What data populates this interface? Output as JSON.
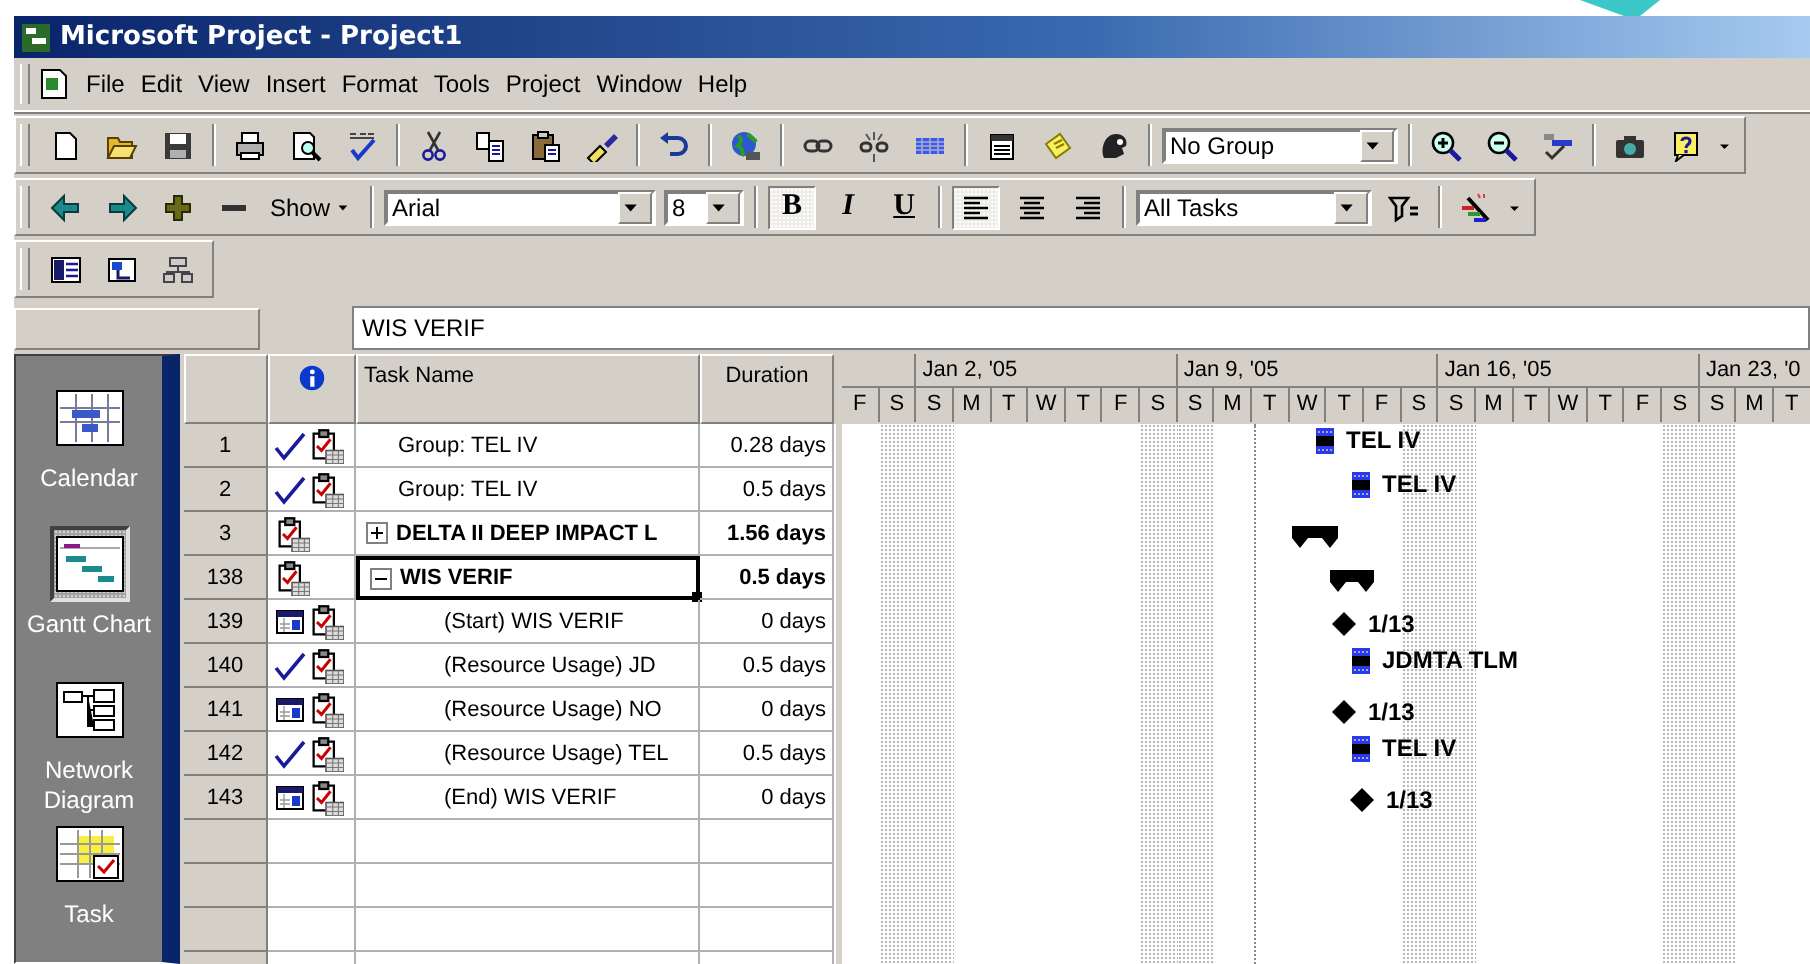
{
  "window": {
    "title": "Microsoft Project - Project1"
  },
  "menu": [
    "File",
    "Edit",
    "View",
    "Insert",
    "Format",
    "Tools",
    "Project",
    "Window",
    "Help"
  ],
  "toolbar_standard": {
    "group_box": {
      "value": "No Group"
    }
  },
  "toolbar_formatting": {
    "show_button": {
      "label": "Show"
    },
    "font_box": {
      "value": "Arial"
    },
    "size_box": {
      "value": "8"
    },
    "style_buttons": [
      {
        "kind": "bold",
        "label": "B",
        "pressed": true
      },
      {
        "kind": "italic",
        "label": "I",
        "pressed": false
      },
      {
        "kind": "underline",
        "label": "U",
        "pressed": false
      }
    ],
    "align_buttons": [
      {
        "kind": "left",
        "pressed": true
      },
      {
        "kind": "center",
        "pressed": false
      },
      {
        "kind": "right",
        "pressed": false
      }
    ],
    "filter_box": {
      "value": "All Tasks"
    }
  },
  "entry_bar": {
    "value": "WIS VERIF"
  },
  "view_bar": [
    {
      "kind": "calendar",
      "label": "Calendar",
      "selected": false
    },
    {
      "kind": "gantt",
      "label": "Gantt Chart",
      "selected": true
    },
    {
      "kind": "network",
      "label": "Network Diagram",
      "selected": false
    },
    {
      "kind": "usage",
      "label": "Task",
      "selected": false
    }
  ],
  "table": {
    "columns": [
      {
        "kind": "id"
      },
      {
        "kind": "indicators"
      },
      {
        "kind": "name",
        "label": "Task Name"
      },
      {
        "kind": "duration",
        "label": "Duration"
      }
    ],
    "tasks": [
      {
        "id": "1",
        "kind": "task",
        "name": "Group: TEL IV",
        "duration": "0.28 days",
        "selected": false,
        "indicators": [
          {
            "kind": "complete"
          },
          {
            "kind": "note"
          }
        ],
        "bar": {
          "kind": "task",
          "label": "TEL IV"
        }
      },
      {
        "id": "2",
        "kind": "task",
        "name": "Group: TEL IV",
        "duration": "0.5 days",
        "selected": false,
        "indicators": [
          {
            "kind": "complete"
          },
          {
            "kind": "note"
          }
        ],
        "bar": {
          "kind": "task",
          "label": "TEL IV"
        }
      },
      {
        "id": "3",
        "kind": "summary",
        "name": "DELTA II DEEP IMPACT L",
        "duration": "1.56 days",
        "selected": false,
        "expanded": false,
        "indicators": [
          {
            "kind": "note"
          }
        ],
        "bar": {
          "kind": "summary"
        }
      },
      {
        "id": "138",
        "kind": "summary",
        "name": "WIS VERIF",
        "duration": "0.5 days",
        "selected": true,
        "expanded": true,
        "indicators": [
          {
            "kind": "note"
          }
        ],
        "bar": {
          "kind": "summary"
        },
        "children": [
          {
            "id": "139",
            "kind": "task",
            "name": "(Start) WIS VERIF",
            "duration": "0 days",
            "selected": false,
            "indicators": [
              {
                "kind": "constraint"
              },
              {
                "kind": "note"
              }
            ],
            "bar": {
              "kind": "milestone",
              "label": "1/13"
            }
          },
          {
            "id": "140",
            "kind": "task",
            "name": "(Resource Usage) JD",
            "duration": "0.5 days",
            "selected": false,
            "indicators": [
              {
                "kind": "complete"
              },
              {
                "kind": "note"
              }
            ],
            "bar": {
              "kind": "task",
              "label": "JDMTA TLM"
            }
          },
          {
            "id": "141",
            "kind": "task",
            "name": "(Resource Usage) NO",
            "duration": "0 days",
            "selected": false,
            "indicators": [
              {
                "kind": "constraint"
              },
              {
                "kind": "note"
              }
            ],
            "bar": {
              "kind": "milestone",
              "label": "1/13"
            }
          },
          {
            "id": "142",
            "kind": "task",
            "name": "(Resource Usage) TEL",
            "duration": "0.5 days",
            "selected": false,
            "indicators": [
              {
                "kind": "complete"
              },
              {
                "kind": "note"
              }
            ],
            "bar": {
              "kind": "task",
              "label": "TEL IV"
            }
          },
          {
            "id": "143",
            "kind": "task",
            "name": "(End) WIS VERIF",
            "duration": "0 days",
            "selected": false,
            "indicators": [
              {
                "kind": "constraint"
              },
              {
                "kind": "note"
              }
            ],
            "bar": {
              "kind": "milestone",
              "label": "1/13"
            }
          }
        ]
      }
    ]
  },
  "gantt": {
    "weeks": [
      "Jan 2, '05",
      "Jan 9, '05",
      "Jan 16, '05",
      "Jan 23, '0"
    ],
    "days": [
      {
        "label": "F",
        "weekend": false
      },
      {
        "label": "S",
        "weekend": true
      },
      {
        "label": "S",
        "weekend": true
      },
      {
        "label": "M",
        "weekend": false
      },
      {
        "label": "T",
        "weekend": false
      },
      {
        "label": "W",
        "weekend": false
      },
      {
        "label": "T",
        "weekend": false
      },
      {
        "label": "F",
        "weekend": false
      },
      {
        "label": "S",
        "weekend": true
      },
      {
        "label": "S",
        "weekend": true
      },
      {
        "label": "M",
        "weekend": false
      },
      {
        "label": "T",
        "weekend": false
      },
      {
        "label": "W",
        "weekend": false
      },
      {
        "label": "T",
        "weekend": false
      },
      {
        "label": "F",
        "weekend": false
      },
      {
        "label": "S",
        "weekend": true
      },
      {
        "label": "S",
        "weekend": true
      },
      {
        "label": "M",
        "weekend": false
      },
      {
        "label": "T",
        "weekend": false
      },
      {
        "label": "W",
        "weekend": false
      },
      {
        "label": "T",
        "weekend": false
      },
      {
        "label": "F",
        "weekend": false
      },
      {
        "label": "S",
        "weekend": true
      },
      {
        "label": "S",
        "weekend": true
      },
      {
        "label": "M",
        "weekend": false
      },
      {
        "label": "T",
        "weekend": false
      }
    ]
  }
}
